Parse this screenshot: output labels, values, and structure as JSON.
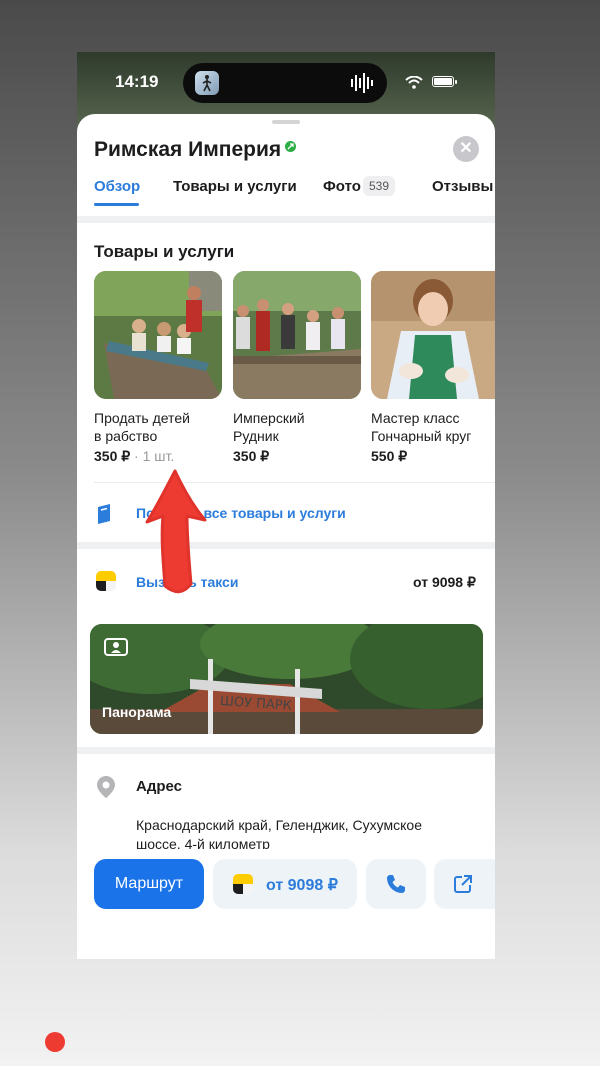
{
  "status_bar": {
    "time": "14:19"
  },
  "header": {
    "title": "Римская Империя",
    "close_symbol": "✕"
  },
  "tabs": [
    {
      "label": "Обзор",
      "active": true
    },
    {
      "label": "Товары и услуги",
      "active": false
    },
    {
      "label": "Фото",
      "badge": "539",
      "active": false
    },
    {
      "label": "Отзывы",
      "active": false
    }
  ],
  "products": {
    "title": "Товары и услуги",
    "items": [
      {
        "name_line1": "Продать детей",
        "name_line2": "в рабство",
        "price": "350 ₽",
        "qty": "· 1 шт."
      },
      {
        "name_line1": "Имперский",
        "name_line2": "Рудник",
        "price": "350 ₽"
      },
      {
        "name_line1": "Мастер класс",
        "name_line2": "Гончарный круг",
        "price": "550 ₽"
      }
    ],
    "show_all": "Показать все товары и услуги"
  },
  "taxi": {
    "label": "Вызвать такси",
    "price": "от 9098 ₽"
  },
  "panorama": {
    "label": "Панорама",
    "sign": "ШОУ ПАРК"
  },
  "address": {
    "label": "Адрес",
    "line1": "Краснодарский край, Геленджик, Сухумское",
    "line2": "шоссе, 4-й километр"
  },
  "bottom_actions": {
    "route": "Маршрут",
    "taxi_price": "от 9098 ₽"
  },
  "colors": {
    "accent": "#2b7cdb",
    "primary_button": "#1a73e8",
    "taxi_yellow": "#ffcc00",
    "annotation_red": "#ee3b32"
  }
}
